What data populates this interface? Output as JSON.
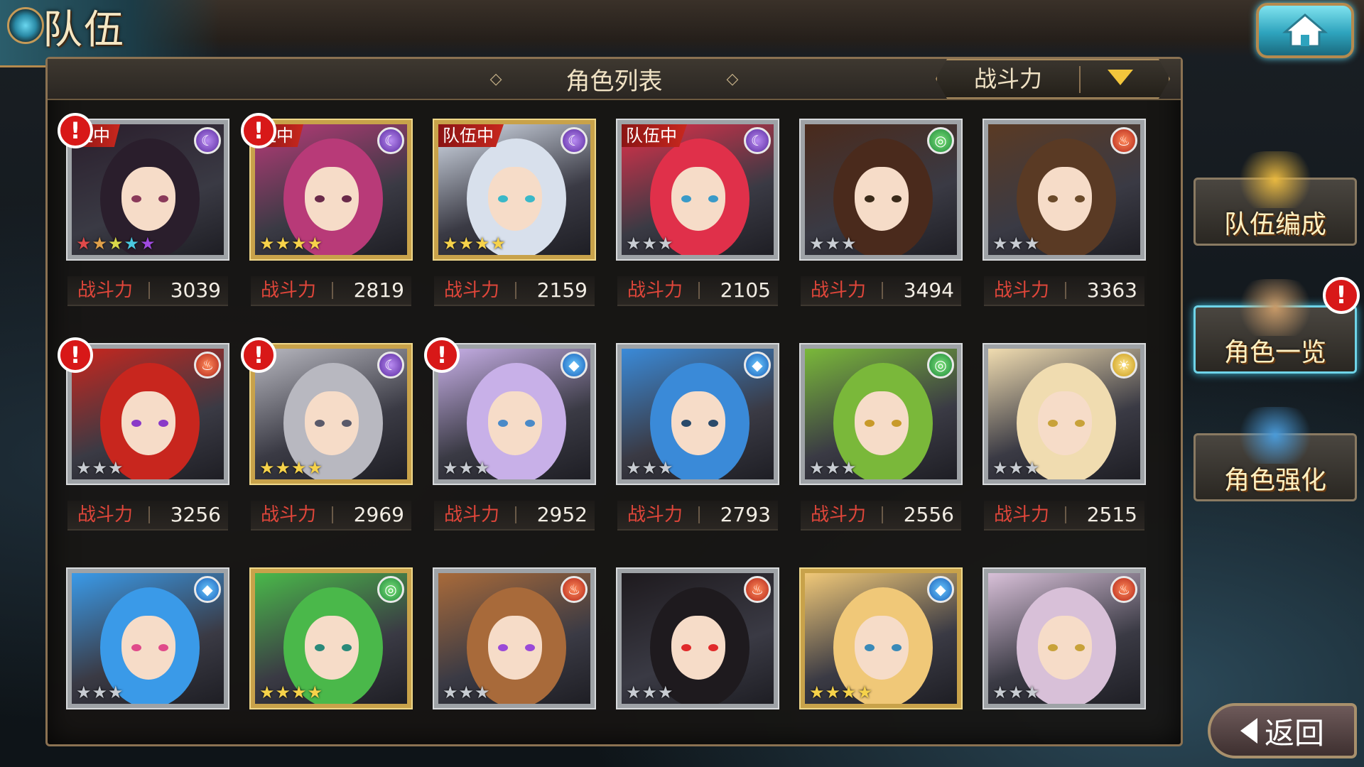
{
  "header": {
    "title": "队伍"
  },
  "panel": {
    "title": "角色列表",
    "sort_label": "战斗力"
  },
  "power_label": "战斗力",
  "alert_mark": "!",
  "characters": [
    {
      "power": "3039",
      "team_tag": "伍中",
      "alert": true,
      "frame": "silver",
      "stars": 5,
      "element": "moon",
      "hair": "#2a1e2c",
      "eyes": "#8a3a5a"
    },
    {
      "power": "2819",
      "team_tag": "伍中",
      "alert": true,
      "frame": "gold",
      "stars": 4,
      "element": "moon",
      "hair": "#b83a78",
      "eyes": "#6a2a4a"
    },
    {
      "power": "2159",
      "team_tag": "队伍中",
      "alert": false,
      "frame": "gold",
      "stars": 4,
      "element": "moon",
      "hair": "#d8e0ec",
      "eyes": "#3ab8c8"
    },
    {
      "power": "2105",
      "team_tag": "队伍中",
      "alert": false,
      "frame": "silver",
      "stars": 3,
      "element": "moon",
      "hair": "#e0304a",
      "eyes": "#3a9ac8"
    },
    {
      "power": "3494",
      "team_tag": "",
      "alert": false,
      "frame": "silver",
      "stars": 3,
      "element": "wind",
      "hair": "#4a2a1c",
      "eyes": "#3a2a1a"
    },
    {
      "power": "3363",
      "team_tag": "",
      "alert": false,
      "frame": "silver",
      "stars": 3,
      "element": "fire",
      "hair": "#5a3a24",
      "eyes": "#6a4a2a"
    },
    {
      "power": "3256",
      "team_tag": "",
      "alert": true,
      "frame": "silver",
      "stars": 3,
      "element": "fire",
      "hair": "#c8261e",
      "eyes": "#8a3ac8"
    },
    {
      "power": "2969",
      "team_tag": "",
      "alert": true,
      "frame": "gold",
      "stars": 4,
      "element": "moon",
      "hair": "#b8b8c0",
      "eyes": "#5a5a6a"
    },
    {
      "power": "2952",
      "team_tag": "",
      "alert": true,
      "frame": "silver",
      "stars": 3,
      "element": "water",
      "hair": "#c8b0e8",
      "eyes": "#4a8ac8"
    },
    {
      "power": "2793",
      "team_tag": "",
      "alert": false,
      "frame": "silver",
      "stars": 3,
      "element": "water",
      "hair": "#3a8ad8",
      "eyes": "#2a4a6a"
    },
    {
      "power": "2556",
      "team_tag": "",
      "alert": false,
      "frame": "silver",
      "stars": 3,
      "element": "wind",
      "hair": "#7ab83a",
      "eyes": "#c89a2a"
    },
    {
      "power": "2515",
      "team_tag": "",
      "alert": false,
      "frame": "silver",
      "stars": 3,
      "element": "light",
      "hair": "#f0dcb0",
      "eyes": "#c8a23a"
    },
    {
      "power": "",
      "team_tag": "",
      "alert": false,
      "frame": "silver",
      "stars": 3,
      "element": "water",
      "hair": "#3a9ae8",
      "eyes": "#e04a8a"
    },
    {
      "power": "",
      "team_tag": "",
      "alert": false,
      "frame": "gold",
      "stars": 4,
      "element": "wind",
      "hair": "#4ab84a",
      "eyes": "#2a8a7a"
    },
    {
      "power": "",
      "team_tag": "",
      "alert": false,
      "frame": "silver",
      "stars": 3,
      "element": "fire",
      "hair": "#a86a3a",
      "eyes": "#9a4ad8"
    },
    {
      "power": "",
      "team_tag": "",
      "alert": false,
      "frame": "silver",
      "stars": 3,
      "element": "fire",
      "hair": "#1e1a1e",
      "eyes": "#e02a2a"
    },
    {
      "power": "",
      "team_tag": "",
      "alert": false,
      "frame": "gold",
      "stars": 4,
      "element": "water",
      "hair": "#f0c878",
      "eyes": "#3a8ab8"
    },
    {
      "power": "",
      "team_tag": "",
      "alert": false,
      "frame": "silver",
      "stars": 3,
      "element": "fire",
      "hair": "#d8c0d8",
      "eyes": "#c8a23a"
    }
  ],
  "side_menu": [
    {
      "label": "队伍编成",
      "active": false,
      "alert": false
    },
    {
      "label": "角色一览",
      "active": true,
      "alert": true
    },
    {
      "label": "角色强化",
      "active": false,
      "alert": false
    }
  ],
  "back_button": {
    "label": "返回"
  },
  "colors": {
    "accent_gold": "#c8a24a",
    "power_red": "#e0463a",
    "alert_red": "#d81818",
    "sort_arrow": "#f3c63c"
  }
}
